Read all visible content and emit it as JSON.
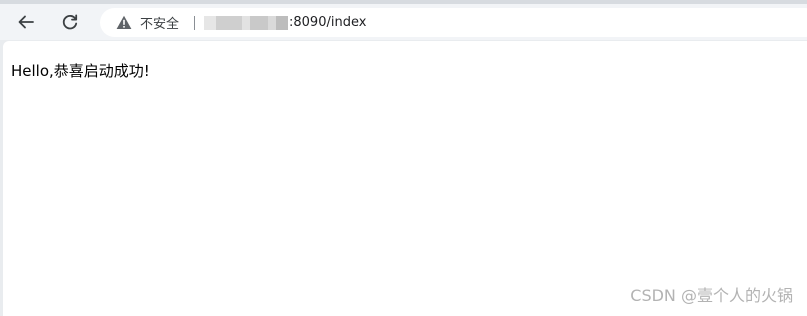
{
  "toolbar": {
    "back_icon": "arrow-left-icon",
    "reload_icon": "reload-icon"
  },
  "omnibox": {
    "security_icon": "warning-triangle-icon",
    "security_label": "不安全",
    "url_visible": ":8090/index"
  },
  "page": {
    "greeting": "Hello,恭喜启动成功!"
  },
  "watermark": {
    "text": "CSDN @壹个人的火锅"
  },
  "colors": {
    "toolbar_bg": "#f2f4f7",
    "omnibox_bg": "#ffffff",
    "content_bg": "#ffffff",
    "watermark": "#b3b3b3"
  }
}
